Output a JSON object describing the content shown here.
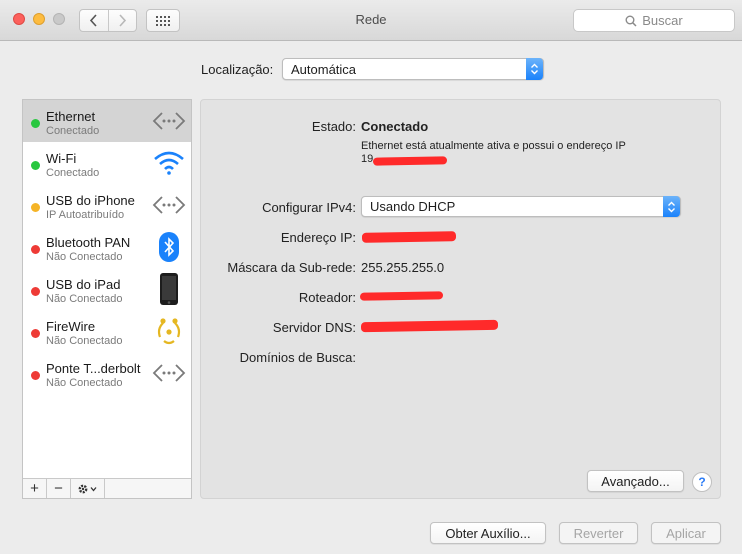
{
  "window": {
    "title": "Rede"
  },
  "toolbar": {
    "back_icon": "chevron-left-icon",
    "forward_icon": "chevron-right-icon",
    "show_all_icon": "grid-icon",
    "search_placeholder": "Buscar"
  },
  "location": {
    "label": "Localização:",
    "value": "Automática"
  },
  "services": [
    {
      "name": "Ethernet",
      "status": "Conectado",
      "dot_color": "#29c740",
      "icon": "ethernet-icon",
      "selected": true
    },
    {
      "name": "Wi-Fi",
      "status": "Conectado",
      "dot_color": "#29c740",
      "icon": "wifi-icon",
      "selected": false
    },
    {
      "name": "USB do iPhone",
      "status": "IP Autoatribuído",
      "dot_color": "#f5b427",
      "icon": "ethernet-icon",
      "selected": false
    },
    {
      "name": "Bluetooth PAN",
      "status": "Não Conectado",
      "dot_color": "#ee3b36",
      "icon": "bluetooth-icon",
      "selected": false
    },
    {
      "name": "USB do iPad",
      "status": "Não Conectado",
      "dot_color": "#ee3b36",
      "icon": "ipad-icon",
      "selected": false
    },
    {
      "name": "FireWire",
      "status": "Não Conectado",
      "dot_color": "#ee3b36",
      "icon": "firewire-icon",
      "selected": false
    },
    {
      "name": "Ponte T...derbolt",
      "status": "Não Conectado",
      "dot_color": "#ee3b36",
      "icon": "ethernet-icon",
      "selected": false
    }
  ],
  "sidebar_controls": {
    "add": "+",
    "remove": "−"
  },
  "details": {
    "status_label": "Estado:",
    "status_value": "Conectado",
    "status_desc": "Ethernet está atualmente ativa e possui o endereço IP",
    "status_desc_ip_prefix": "19",
    "configure_label": "Configurar IPv4:",
    "configure_value": "Usando DHCP",
    "ip_label": "Endereço IP:",
    "ip_prefix": "",
    "subnet_label": "Máscara da Sub-rede:",
    "subnet_value": "255.255.255.0",
    "router_label": "Roteador:",
    "dns_label": "Servidor DNS:",
    "search_domains_label": "Domínios de Busca:",
    "search_domains_value": ""
  },
  "buttons": {
    "advanced": "Avançado...",
    "help": "?",
    "assist": "Obter Auxílio...",
    "revert": "Reverter",
    "apply": "Aplicar"
  },
  "colors": {
    "accent": "#1a82fb",
    "redaction": "#ff2a2a"
  }
}
